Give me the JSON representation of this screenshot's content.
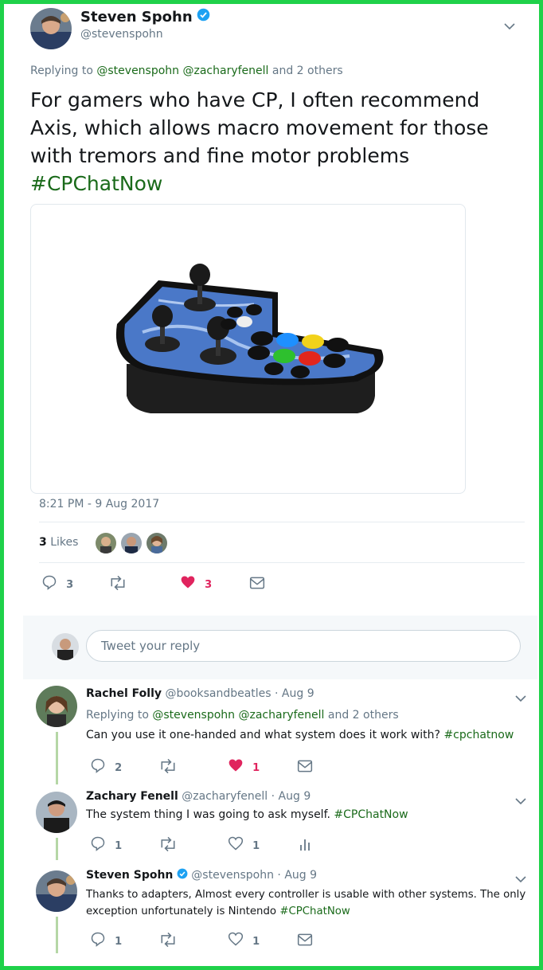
{
  "main_tweet": {
    "author_name": "Steven Spohn",
    "handle": "@stevenspohn",
    "replying_prefix": "Replying to",
    "replying_users": "@stevenspohn @zacharyfenell",
    "replying_suffix": "and 2 others",
    "text": "For gamers who have CP, I often recommend Axis, which allows macro movement for those with tremors and fine motor problems",
    "hashtag": "#CPChatNow",
    "timestamp": "8:21 PM - 9 Aug 2017",
    "likes_count": "3",
    "likes_label": "Likes",
    "actions": {
      "replies": "3",
      "retweets": "",
      "likes": "3"
    }
  },
  "reply_input": {
    "placeholder": "Tweet your reply"
  },
  "replies": [
    {
      "author_name": "Rachel Folly",
      "handle": "@booksandbeatles",
      "date": "· Aug 9",
      "replying_prefix": "Replying to",
      "replying_users": "@stevenspohn @zacharyfenell",
      "replying_suffix": "and 2 others",
      "text": "Can you use it one-handed and what system does it work with?",
      "hashtag": "#cpchatnow",
      "replies": "2",
      "likes": "1"
    },
    {
      "author_name": "Zachary Fenell",
      "handle": "@zacharyfenell",
      "date": "· Aug 9",
      "text": "The system thing I was going to ask myself.",
      "hashtag": "#CPChatNow",
      "replies": "1",
      "likes": "1"
    },
    {
      "author_name": "Steven Spohn",
      "handle": "@stevenspohn",
      "date": "· Aug 9",
      "text_line1": "Thanks to adapters, Almost every controller is usable with other systems. The only",
      "text_line2": "exception unfortunately is Nintendo",
      "hashtag": "#CPChatNow",
      "replies": "1",
      "likes": "1"
    }
  ],
  "colors": {
    "frame": "#1fd14a",
    "link_green": "#1a6a1a",
    "like_red": "#e0245e",
    "verified_blue": "#1da1f2"
  }
}
